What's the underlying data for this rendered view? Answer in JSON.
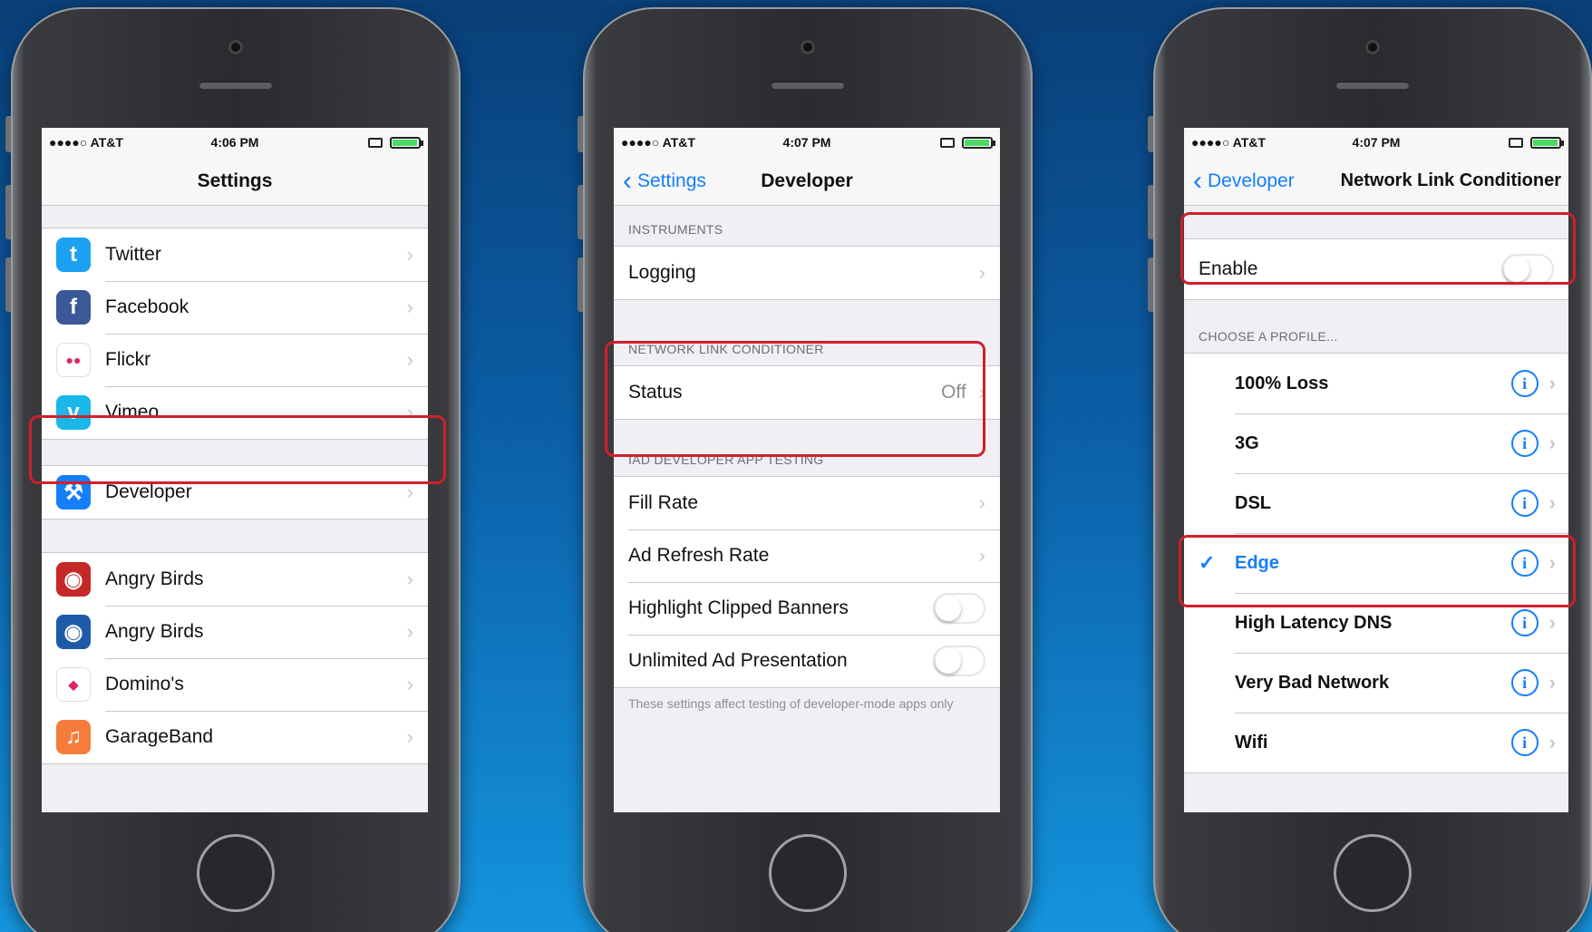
{
  "colors": {
    "accent": "#157efb",
    "highlight": "#d0202a"
  },
  "phone1": {
    "status": {
      "carrier": "●●●●○ AT&T",
      "time": "4:06 PM"
    },
    "nav": {
      "title": "Settings"
    },
    "social": [
      {
        "label": "Twitter",
        "icon": "twitter-icon",
        "color": "#1da1f2",
        "glyph": "t"
      },
      {
        "label": "Facebook",
        "icon": "facebook-icon",
        "color": "#3b5998",
        "glyph": "f"
      },
      {
        "label": "Flickr",
        "icon": "flickr-icon",
        "color": "#ffffff",
        "glyph": "●●"
      },
      {
        "label": "Vimeo",
        "icon": "vimeo-icon",
        "color": "#1ab7ea",
        "glyph": "v"
      }
    ],
    "developer": {
      "label": "Developer",
      "icon": "hammer-icon",
      "color": "#157efb",
      "glyph": "⚒"
    },
    "apps": [
      {
        "label": "Angry Birds",
        "icon": "angry-birds-icon",
        "color": "#c62828",
        "glyph": "◉"
      },
      {
        "label": "Angry Birds",
        "icon": "angry-birds-icon",
        "color": "#1e5aa8",
        "glyph": "◉"
      },
      {
        "label": "Domino's",
        "icon": "dominos-icon",
        "color": "#ffffff",
        "glyph": "◆"
      },
      {
        "label": "GarageBand",
        "icon": "garageband-icon",
        "color": "#f57c3a",
        "glyph": "♫"
      }
    ]
  },
  "phone2": {
    "status": {
      "carrier": "●●●●○ AT&T",
      "time": "4:07 PM"
    },
    "nav": {
      "back": "Settings",
      "title": "Developer"
    },
    "instruments_header": "INSTRUMENTS",
    "logging": "Logging",
    "nlc_header": "NETWORK LINK CONDITIONER",
    "status_row": {
      "label": "Status",
      "value": "Off"
    },
    "iad_header": "IAD DEVELOPER APP TESTING",
    "fill_rate": "Fill Rate",
    "ad_refresh": "Ad Refresh Rate",
    "highlight_banners": "Highlight Clipped Banners",
    "unlimited_ad": "Unlimited Ad Presentation",
    "note": "These settings affect testing of developer-mode apps only"
  },
  "phone3": {
    "status": {
      "carrier": "●●●●○ AT&T",
      "time": "4:07 PM"
    },
    "nav": {
      "back": "Developer",
      "title": "Network Link Conditioner"
    },
    "enable": "Enable",
    "profile_header": "CHOOSE A PROFILE...",
    "profiles": [
      {
        "label": "100% Loss",
        "selected": false
      },
      {
        "label": "3G",
        "selected": false
      },
      {
        "label": "DSL",
        "selected": false
      },
      {
        "label": "Edge",
        "selected": true
      },
      {
        "label": "High Latency DNS",
        "selected": false
      },
      {
        "label": "Very Bad Network",
        "selected": false
      },
      {
        "label": "Wifi",
        "selected": false
      }
    ]
  }
}
